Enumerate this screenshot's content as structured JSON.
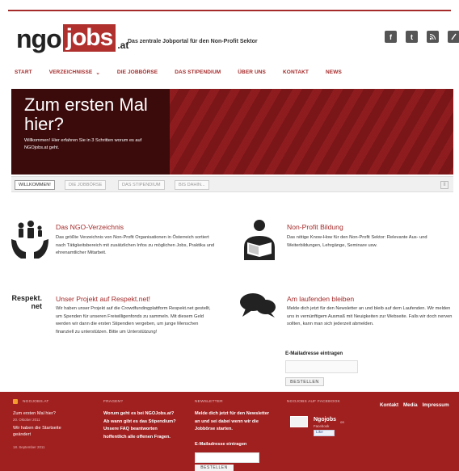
{
  "header": {
    "logo_ngo": "ngo",
    "logo_jobs": "jobs",
    "logo_at": ".at",
    "tagline": "Das zentrale Jobportal für den Non-Profit Sektor",
    "social": [
      "f",
      "t",
      "rss",
      "x"
    ]
  },
  "nav": {
    "items": [
      "START",
      "VERZEICHNISSE",
      "DIE JOBBÖRSE",
      "DAS STIPENDIUM",
      "ÜBER UNS",
      "KONTAKT",
      "NEWS"
    ],
    "dropdown_indicator": "⌄"
  },
  "hero": {
    "title_line1": "Zum ersten Mal",
    "title_line2": "hier?",
    "subtitle": "Willkommen! Hier erfahren Sie in 3 Schritten worum es auf NGOjobs.at geht."
  },
  "slider": {
    "tabs": [
      "WILLKOMMEN!",
      "DIE JOBBÖRSE",
      "DAS STIPENDIUM",
      "BIS DAHIN..."
    ],
    "active_index": 0,
    "pause_label": "II"
  },
  "features": [
    {
      "title": "Das NGO-Verzeichnis",
      "text": "Das größte Verzeichnis von Non-Profit Organisationen in Österreich sortiert nach Tätigkeitsbereich mit zusätzlichen Infos zu möglichen Jobs, Praktika und ehrenamtlicher Mitarbeit.",
      "icon": "family-hands-icon"
    },
    {
      "title": "Non-Profit Bildung",
      "text": "Das nötige Know-How für den Non-Profit Sektor: Relevante Aus- und Weiterbildungen, Lehrgänge, Seminare usw.",
      "icon": "reader-icon"
    },
    {
      "title": "Unser Projekt auf Respekt.net!",
      "text": "Wir haben unser Projekt auf die Crowdfundingplattform Respekt.net gestellt, um Spenden für unseren Freiwilligenfonds zu sammeln. Mit diesem Geld werden wir dann die ersten Stipendien vergeben, um junge Menschen finanziell zu unterstützen. Bitte um Unterstützung!",
      "logo_line1": "Respekt.",
      "logo_line2": "net"
    },
    {
      "title": "Am laufenden bleiben",
      "text": "Melde dich jetzt für den Newsletter an und bleib auf dem Laufenden. Wir melden uns in vernünftigem Ausmaß mit Neuigkeiten zur Webseite. Falls wir doch nerven sollten, kann man sich jederzeit abmelden.",
      "icon": "speech-bubbles-icon"
    }
  ],
  "newsletter": {
    "email_label": "E-Mailadresse eintragen",
    "email_value": "",
    "button": "BESTELLEN"
  },
  "footer": {
    "col1_heading": "NGOJOBS.AT",
    "col1_links": [
      {
        "title": "Zum ersten Mal hier?",
        "date": "20. Oktober 2011"
      },
      {
        "title": "Wir haben die Startseite geändert",
        "date": "18. September 2011"
      }
    ],
    "col2_heading": "FRAGEN?",
    "col2_text": "Worum geht es bei NGOJobs.at? Ab wann gibt es das Stipendium? Unsere FAQ beantworten hoffentlich alle offenen Fragen.",
    "col3_heading": "NEWSLETTER",
    "col3_text": "Melde dich jetzt für den Newsletter an und sei dabei wenn wir die Jobbörse starten.",
    "col3_email_label": "E-Mailadresse eintragen",
    "col3_button": "BESTELLEN",
    "col4_heading": "NGOJOBS AUF FACEBOOK",
    "fb_name": "Ngojobs",
    "fb_on": "on",
    "fb_sub": "Facebook",
    "fb_like": "Like",
    "links": [
      "Kontakt",
      "Media",
      "Impressum"
    ]
  },
  "colors": {
    "brand": "#b0302e",
    "footer": "#a01f1f",
    "hero_dark": "#3b0a0b"
  }
}
